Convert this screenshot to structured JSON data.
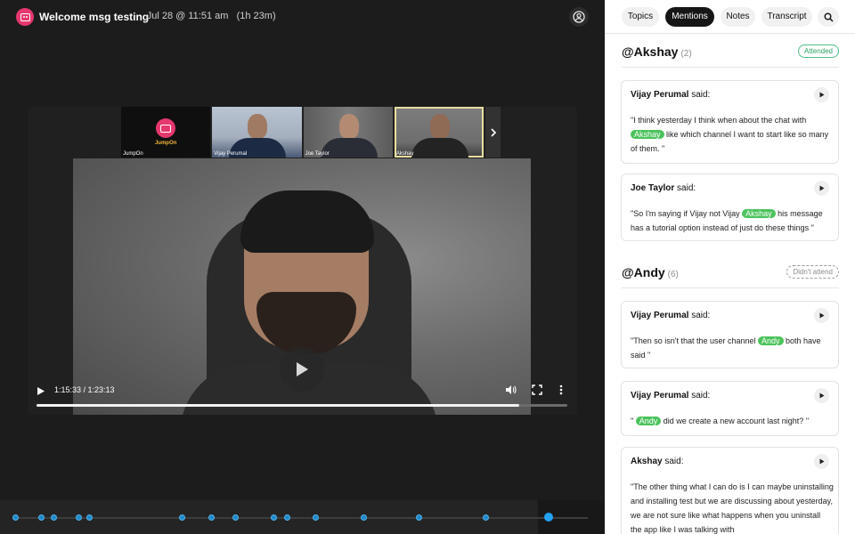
{
  "meeting": {
    "title": "Welcome msg testing",
    "date": "Jul 28 @ 11:51 am",
    "duration": "(1h 23m)",
    "separator": "·"
  },
  "participants": [
    {
      "label": "JumpOn"
    },
    {
      "label": "Vijay Perumal"
    },
    {
      "label": "Joe Taylor"
    },
    {
      "label": "Akshay"
    }
  ],
  "brand": {
    "logo_text": "JumpOn",
    "accent": "#e5386e"
  },
  "player": {
    "time_display": "1:15:33 / 1:23:13",
    "progress_fraction": 0.909
  },
  "timeline": {
    "markers": [
      0.006,
      0.05,
      0.072,
      0.115,
      0.134,
      0.295,
      0.346,
      0.387,
      0.455,
      0.477,
      0.527,
      0.61,
      0.707,
      0.823,
      0.932
    ],
    "current_marker": 0.932
  },
  "tabs": [
    {
      "label": "Topics",
      "active": false
    },
    {
      "label": "Mentions",
      "active": true
    },
    {
      "label": "Notes",
      "active": false
    },
    {
      "label": "Transcript",
      "active": false
    }
  ],
  "mentions": [
    {
      "name": "@Akshay",
      "count": "(2)",
      "status": "Attended",
      "items": [
        {
          "speaker": "Vijay Perumal",
          "said": " said:",
          "before": "\"I think yesterday I think when about the chat with ",
          "highlight": "Akshay",
          "after": " like which channel I want to start like so many of them. \""
        },
        {
          "speaker": "Joe Taylor",
          "said": " said:",
          "before": "\"So I'm saying if Vijay not Vijay ",
          "highlight": "Akshay",
          "after": " his message has a tutorial option instead of just do these things \""
        }
      ]
    },
    {
      "name": "@Andy",
      "count": "(6)",
      "status": "Didn't attend",
      "items": [
        {
          "speaker": "Vijay Perumal",
          "said": " said:",
          "before": "\"Then so isn't that the user channel ",
          "highlight": "Andy",
          "after": " both have said \""
        },
        {
          "speaker": "Vijay Perumal",
          "said": " said:",
          "before": "\" ",
          "highlight": "Andy",
          "after": " did we create a new account last night? \""
        },
        {
          "speaker": "Akshay",
          "said": " said:",
          "before": "\"The other thing what I can do is I can maybe uninstalling and installing test but we are discussing about yesterday, we are not sure like what happens when you uninstall the app like I was talking with",
          "highlight": "",
          "after": ""
        }
      ]
    }
  ]
}
